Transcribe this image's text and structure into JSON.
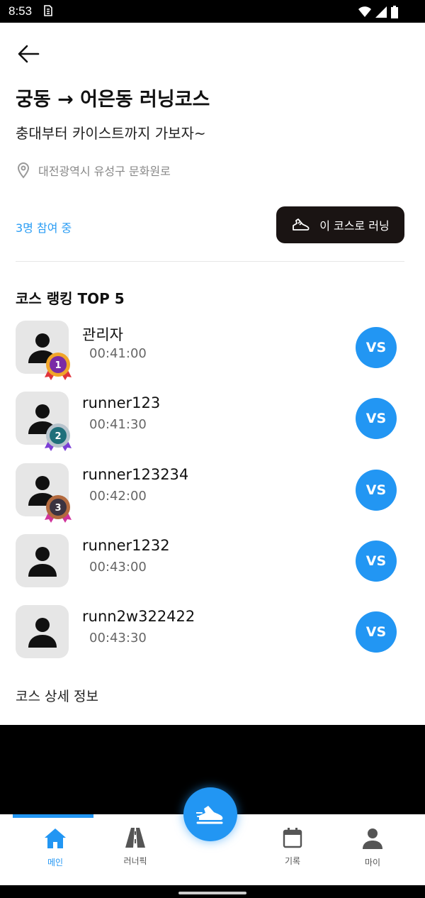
{
  "status_bar": {
    "time": "8:53"
  },
  "header": {
    "title": "궁동 → 어은동 러닝코스",
    "subtitle": "충대부터 카이스트까지 가보자~",
    "location": "대전광역시 유성구 문화원로"
  },
  "participation": {
    "text": "3명 참여 중"
  },
  "run_button": {
    "label": "이 코스로 러닝"
  },
  "ranking": {
    "title": "코스 랭킹 TOP 5",
    "vs_label": "VS",
    "entries": [
      {
        "name": "관리자",
        "time": "00:41:00",
        "medal": "1"
      },
      {
        "name": "runner123",
        "time": "00:41:30",
        "medal": "2"
      },
      {
        "name": "runner123234",
        "time": "00:42:00",
        "medal": "3"
      },
      {
        "name": "runner1232",
        "time": "00:43:00"
      },
      {
        "name": "runn2w322422",
        "time": "00:43:30"
      }
    ]
  },
  "detail": {
    "title": "코스 상세 정보"
  },
  "nav": {
    "items": [
      {
        "label": "메인",
        "icon": "home-icon",
        "active": true
      },
      {
        "label": "러너픽",
        "icon": "road-icon",
        "active": false
      },
      {
        "label": "기록",
        "icon": "calendar-icon",
        "active": false
      },
      {
        "label": "마이",
        "icon": "person-icon",
        "active": false
      }
    ],
    "fab_icon": "running-shoe-icon"
  },
  "colors": {
    "accent": "#2296f3",
    "dark_button": "#1a1413",
    "avatar_bg": "#e6e6e6"
  }
}
